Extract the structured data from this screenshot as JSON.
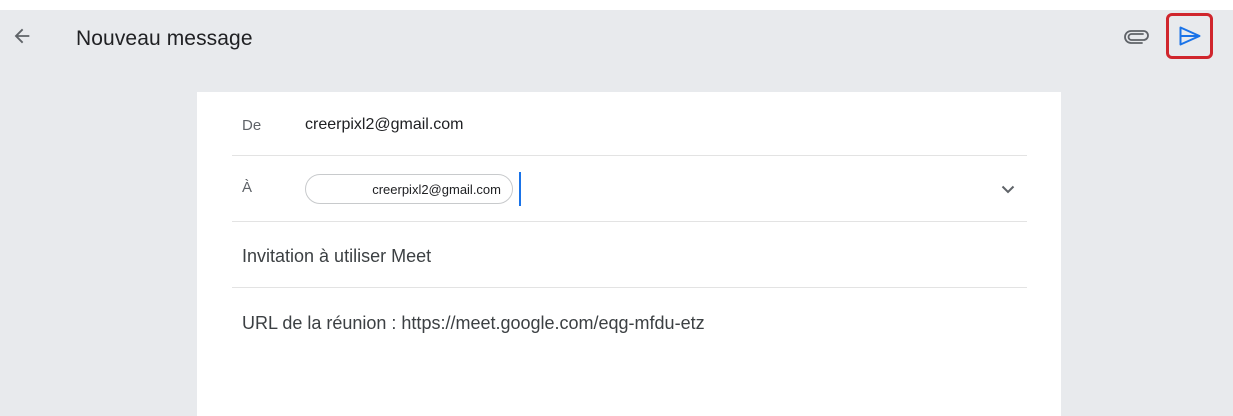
{
  "header": {
    "title": "Nouveau message",
    "back_icon": "arrow-back-icon",
    "attach_icon": "paperclip-icon",
    "send_icon": "send-icon",
    "highlight_color": "#d0262d",
    "send_color": "#1a73e8"
  },
  "compose": {
    "from_label": "De",
    "from_value": "creerpixl2@gmail.com",
    "to_label": "À",
    "to_chip": "creerpixl2@gmail.com",
    "to_input_value": "",
    "expand_icon": "chevron-down-icon",
    "subject": "Invitation à utiliser Meet",
    "body": "URL de la réunion : https://meet.google.com/eqg-mfdu-etz"
  }
}
